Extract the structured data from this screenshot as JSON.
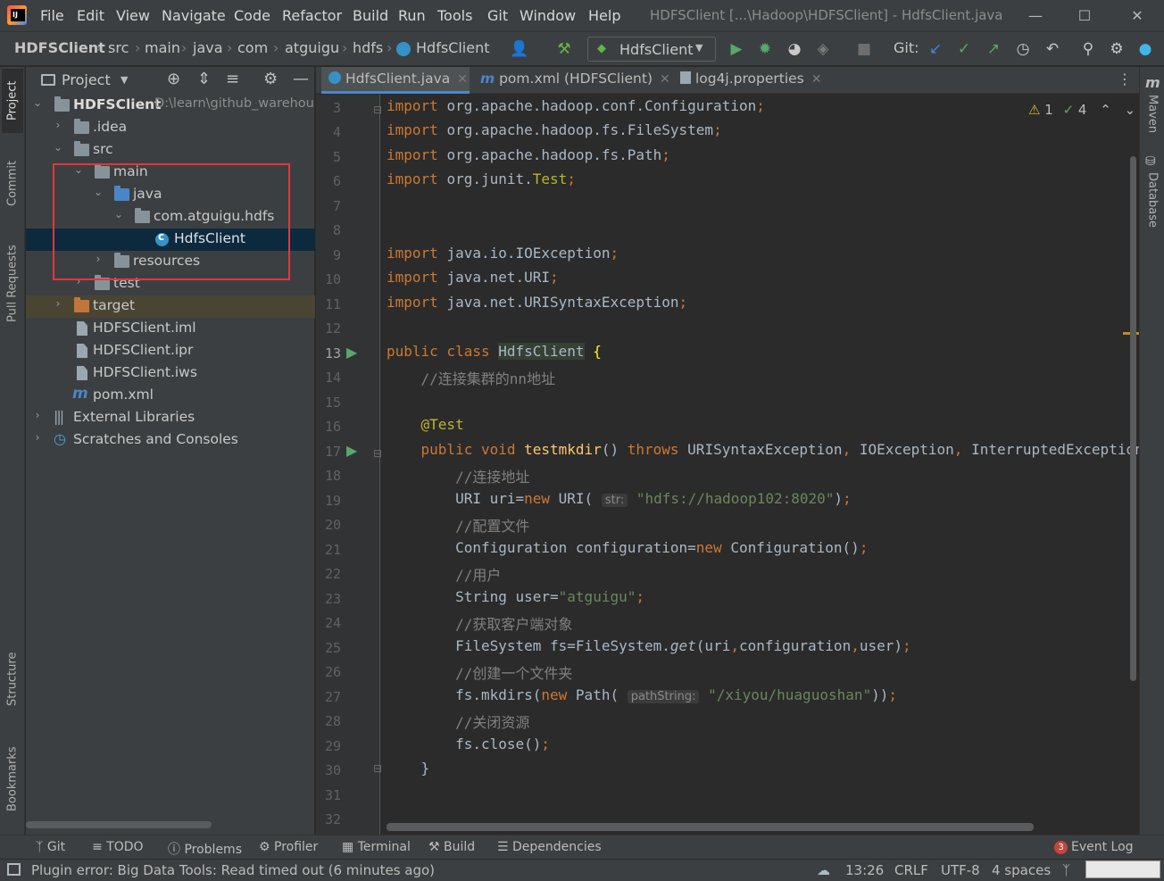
{
  "titlebar": {
    "menus": [
      "File",
      "Edit",
      "View",
      "Navigate",
      "Code",
      "Refactor",
      "Build",
      "Run",
      "Tools",
      "Git",
      "Window",
      "Help"
    ],
    "window_title": "HDFSClient [...\\Hadoop\\HDFSClient] - HdfsClient.java"
  },
  "navbar": {
    "breadcrumbs": [
      "HDFSClient",
      "src",
      "main",
      "java",
      "com",
      "atguigu",
      "hdfs",
      "HdfsClient"
    ],
    "run_config": "HdfsClient",
    "git_label": "Git:"
  },
  "left_strip": {
    "tabs": [
      "Project",
      "Commit",
      "Pull Requests",
      "Structure",
      "Bookmarks"
    ]
  },
  "right_strip": {
    "tabs": [
      "Maven",
      "Database"
    ]
  },
  "project": {
    "header_label": "Project",
    "tree": [
      {
        "label": "HDFSClient",
        "path_hint": "D:\\learn\\github_warehou",
        "bold": true
      },
      {
        "label": ".idea"
      },
      {
        "label": "src"
      },
      {
        "label": "main"
      },
      {
        "label": "java"
      },
      {
        "label": "com.atguigu.hdfs"
      },
      {
        "label": "HdfsClient"
      },
      {
        "label": "resources"
      },
      {
        "label": "test"
      },
      {
        "label": "target"
      },
      {
        "label": "HDFSClient.iml"
      },
      {
        "label": "HDFSClient.ipr"
      },
      {
        "label": "HDFSClient.iws"
      },
      {
        "label": "pom.xml"
      },
      {
        "label": "External Libraries"
      },
      {
        "label": "Scratches and Consoles"
      }
    ]
  },
  "editor": {
    "tabs": [
      {
        "label": "HdfsClient.java",
        "active": true
      },
      {
        "label": "pom.xml (HDFSClient)",
        "active": false
      },
      {
        "label": "log4j.properties",
        "active": false
      }
    ],
    "inspections": {
      "warnings": "1",
      "checks": "4"
    },
    "line_numbers": [
      "3",
      "4",
      "5",
      "6",
      "7",
      "8",
      "9",
      "10",
      "11",
      "12",
      "13",
      "14",
      "15",
      "16",
      "17",
      "18",
      "19",
      "20",
      "21",
      "22",
      "23",
      "24",
      "25",
      "26",
      "27",
      "28",
      "29",
      "30",
      "31",
      "32"
    ],
    "current_line": "13",
    "hint_str": "str:",
    "hint_path": "pathString:",
    "uri_literal": "\"hdfs://hadoop102:8020\"",
    "user_literal": "\"atguigu\"",
    "path_literal": "\"/xiyou/huaguoshan\"",
    "comments": [
      "//连接集群的nn地址",
      "//连接地址",
      "//配置文件",
      "//用户",
      "//获取客户端对象",
      "//创建一个文件夹",
      "//关闭资源"
    ]
  },
  "bottom_tools": [
    "Git",
    "TODO",
    "Problems",
    "Profiler",
    "Terminal",
    "Build",
    "Dependencies"
  ],
  "event_log": {
    "label": "Event Log",
    "count": "3"
  },
  "status": {
    "message": "Plugin error: Big Data Tools: Read timed out (6 minutes ago)",
    "position": "13:26",
    "line_sep": "CRLF",
    "encoding": "UTF-8",
    "indent": "4 spaces"
  },
  "colors": {
    "keyword": "#cc7832",
    "string": "#6a8759",
    "comment": "#808080",
    "annotation": "#bbb529",
    "method": "#ffc66d",
    "selection_box": "#e0383f"
  }
}
